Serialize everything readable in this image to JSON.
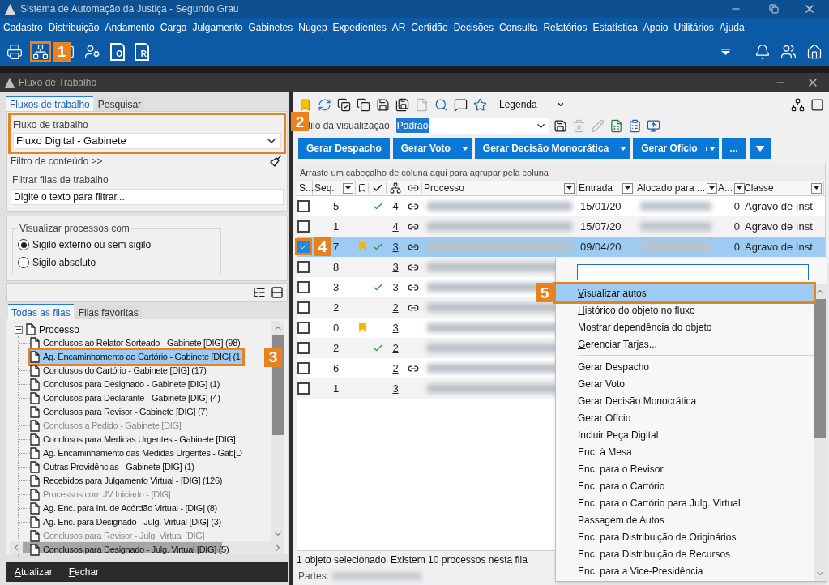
{
  "app_title": "Sistema de Automação da Justiça - Segundo Grau",
  "menu": [
    "Cadastro",
    "Distribuição",
    "Andamento",
    "Carga",
    "Julgamento",
    "Gabinetes",
    "Nugep",
    "Expedientes",
    "AR",
    "Certidão",
    "Decisões",
    "Consulta",
    "Relatórios",
    "Estatística",
    "Apoio",
    "Utilitários",
    "Ajuda"
  ],
  "toolbar": [
    {
      "kind": "printer"
    },
    {
      "kind": "org",
      "callout": "1"
    },
    {
      "kind": "window"
    },
    {
      "kind": "user-gear"
    },
    {
      "kind": "doc-letter",
      "letter": "O"
    },
    {
      "kind": "doc-letter",
      "letter": "R"
    }
  ],
  "window_title": "Fluxo de Trabalho",
  "left_tabs": [
    {
      "label": "Fluxos de trabalho",
      "selected": true
    },
    {
      "label": "Pesquisar",
      "selected": false
    }
  ],
  "workflow": {
    "label": "Fluxo de trabalho",
    "value": "Fluxo Digital - Gabinete",
    "callout": "2"
  },
  "content_filter": "Filtro de conteúdo >>",
  "queue_filter": {
    "label": "Filtrar filas de trabalho",
    "placeholder": "Digite o texto para filtrar..."
  },
  "visibility": {
    "legend": "Visualizar processos com",
    "options": [
      {
        "label": "Sigilo externo ou sem sigilo",
        "selected": true
      },
      {
        "label": "Sigilo absoluto",
        "selected": false
      }
    ]
  },
  "queue_tabs": [
    {
      "label": "Todas as filas",
      "selected": true
    },
    {
      "label": "Filas favoritas",
      "selected": false
    }
  ],
  "tree": {
    "label": "Processo",
    "expanded": true,
    "children": [
      {
        "label": "Conclusos ao Relator Sorteado - Gabinete [DIG] (98)",
        "selected": false,
        "disabled": false
      },
      {
        "label": "Ag. Encaminhamento ao Cartório - Gabinete [DIG] (1",
        "selected": true,
        "disabled": false,
        "callout": "3"
      },
      {
        "label": "Conclusos do Cartório - Gabinete [DIG] (17)",
        "selected": false,
        "disabled": false
      },
      {
        "label": "Conclusos para Designado - Gabinete [DIG] (1)",
        "selected": false,
        "disabled": false
      },
      {
        "label": "Conclusos para Declarante - Gabinete [DIG] (4)",
        "selected": false,
        "disabled": false
      },
      {
        "label": "Conclusos para Revisor - Gabinete [DIG] (7)",
        "selected": false,
        "disabled": false
      },
      {
        "label": "Conclusos a Pedido - Gabinete [DIG]",
        "selected": false,
        "disabled": true
      },
      {
        "label": "Conclusos para Medidas Urgentes - Gabinete [DIG]",
        "selected": false,
        "disabled": false
      },
      {
        "label": "Ag. Encaminhamento das Medidas Urgentes - Gab[D",
        "selected": false,
        "disabled": false
      },
      {
        "label": "Outras Providências - Gabinete [DIG] (1)",
        "selected": false,
        "disabled": false
      },
      {
        "label": "Recebidos para Julgamento Virtual - [DIG] (126)",
        "selected": false,
        "disabled": false
      },
      {
        "label": "Processos com JV Iniciado - [DIG]",
        "selected": false,
        "disabled": true
      },
      {
        "label": "Ag. Enc. para Int. de Acórdão Virtual - [DIG] (8)",
        "selected": false,
        "disabled": false
      },
      {
        "label": "Ag. Enc. para Designado - Julg. Virtual [DIG] (3)",
        "selected": false,
        "disabled": false
      },
      {
        "label": "Conclusos para Revisor - Julg. Virtual [DIG]",
        "selected": false,
        "disabled": true
      },
      {
        "label": "Conclusos para Designado - Julg. Virtual [DIG] (5)",
        "selected": false,
        "disabled": false
      }
    ]
  },
  "footer_buttons": [
    {
      "label": "Atualizar",
      "accelerator": true
    },
    {
      "label": "Fechar",
      "accelerator": true
    }
  ],
  "right_toolbar": {
    "tools": [
      {
        "kind": "bookmark",
        "disabled": false
      },
      {
        "kind": "refresh",
        "disabled": false
      },
      {
        "kind": "check-copy",
        "disabled": false
      },
      {
        "kind": "copy",
        "disabled": false
      },
      {
        "kind": "save",
        "disabled": false
      },
      {
        "kind": "save-all",
        "disabled": false
      },
      {
        "kind": "file",
        "disabled": true
      },
      {
        "kind": "search",
        "disabled": false
      },
      {
        "kind": "comment",
        "disabled": false
      },
      {
        "kind": "star",
        "disabled": false
      }
    ],
    "legend": "Legenda",
    "side_tools": [
      {
        "kind": "network",
        "disabled": false
      },
      {
        "kind": "rows",
        "disabled": false
      }
    ]
  },
  "view_style": {
    "label": "tilo da visualização",
    "value": "Padrão",
    "tools": [
      {
        "kind": "save",
        "disabled": false
      },
      {
        "kind": "trash",
        "disabled": true
      },
      {
        "kind": "pencil",
        "disabled": true
      },
      {
        "kind": "spreadsheet",
        "disabled": false
      },
      {
        "kind": "clipboard",
        "disabled": false
      },
      {
        "kind": "monitor-up",
        "disabled": false
      }
    ]
  },
  "action_buttons": [
    {
      "label": "Gerar Despacho",
      "dropdown": false
    },
    {
      "label": "Gerar Voto",
      "dropdown": true
    },
    {
      "label": "Gerar Decisão Monocrática",
      "dropdown": true
    },
    {
      "label": "Gerar Ofício",
      "dropdown": true
    },
    {
      "label": "...",
      "dropdown": false
    }
  ],
  "group_hint": "Arraste um cabeçalho de coluna aqui para agrupar pela coluna",
  "columns": [
    {
      "label": "S..."
    },
    {
      "label": "Seq.",
      "filter": true
    },
    {
      "label": "Processo",
      "filter": true
    },
    {
      "label": "Entrada",
      "filter": true
    },
    {
      "label": "Alocado para ...",
      "filter": true
    },
    {
      "label": "A...",
      "filter": true
    },
    {
      "label": "Classe",
      "filter": true
    }
  ],
  "rows": [
    {
      "checked": false,
      "selected": false,
      "seq": "5",
      "flagged": false,
      "done": true,
      "count": "4",
      "linked": true,
      "entrada": "15/01/20",
      "a": "0",
      "classe": "Agravo de Inst"
    },
    {
      "checked": false,
      "selected": false,
      "seq": "1",
      "flagged": false,
      "done": false,
      "count": "4",
      "linked": true,
      "entrada": "15/07/20",
      "a": "0",
      "classe": "Agravo de Inst"
    },
    {
      "checked": true,
      "selected": true,
      "seq": "7",
      "flagged": true,
      "done": true,
      "count": "3",
      "linked": true,
      "entrada": "09/04/20",
      "a": "0",
      "classe": "Agravo de Inst",
      "callout": "4"
    },
    {
      "checked": false,
      "selected": false,
      "seq": "8",
      "flagged": false,
      "done": false,
      "count": "3",
      "linked": true
    },
    {
      "checked": false,
      "selected": false,
      "seq": "3",
      "flagged": false,
      "done": true,
      "count": "3",
      "linked": true
    },
    {
      "checked": false,
      "selected": false,
      "seq": "2",
      "flagged": false,
      "done": false,
      "count": "2",
      "linked": true
    },
    {
      "checked": false,
      "selected": false,
      "seq": "0",
      "flagged": true,
      "done": false,
      "count": "3",
      "linked": false
    },
    {
      "checked": false,
      "selected": false,
      "seq": "2",
      "flagged": false,
      "done": true,
      "count": "2",
      "linked": false
    },
    {
      "checked": false,
      "selected": false,
      "seq": "6",
      "flagged": false,
      "done": false,
      "count": "2",
      "linked": true
    },
    {
      "checked": false,
      "selected": false,
      "seq": "1",
      "flagged": false,
      "done": false,
      "count": "3",
      "linked": false
    }
  ],
  "status": {
    "selection": "1 objeto selecionado",
    "total": "Existem 10 processos nesta fila",
    "parties_label": "Partes:"
  },
  "context_menu": {
    "items": [
      {
        "kind": "item",
        "label": "Visualizar autos",
        "accelerator": true,
        "selected": true,
        "callout": "5"
      },
      {
        "kind": "item",
        "label": "Histórico do objeto no fluxo",
        "accelerator": true,
        "selected": false
      },
      {
        "kind": "item",
        "label": "Mostrar dependência do objeto",
        "accelerator": false,
        "selected": false
      },
      {
        "kind": "item",
        "label": "Gerenciar Tarjas...",
        "accelerator": true,
        "selected": false
      },
      {
        "kind": "separator"
      },
      {
        "kind": "item",
        "label": "Gerar Despacho",
        "accelerator": false,
        "selected": false
      },
      {
        "kind": "item",
        "label": "Gerar Voto",
        "accelerator": false,
        "selected": false
      },
      {
        "kind": "item",
        "label": "Gerar Decisão Monocrática",
        "accelerator": false,
        "selected": false
      },
      {
        "kind": "item",
        "label": "Gerar Ofício",
        "accelerator": false,
        "selected": false
      },
      {
        "kind": "item",
        "label": "Incluir Peça Digital",
        "accelerator": false,
        "selected": false
      },
      {
        "kind": "item",
        "label": "Enc. à Mesa",
        "accelerator": false,
        "selected": false
      },
      {
        "kind": "item",
        "label": "Enc. para o Revisor",
        "accelerator": false,
        "selected": false
      },
      {
        "kind": "item",
        "label": "Enc. para o Cartório",
        "accelerator": false,
        "selected": false
      },
      {
        "kind": "item",
        "label": "Enc. para o Cartório para Julg. Virtual",
        "accelerator": false,
        "selected": false
      },
      {
        "kind": "item",
        "label": "Passagem de Autos",
        "accelerator": false,
        "selected": false
      },
      {
        "kind": "item",
        "label": "Enc. para Distribuição de Originários",
        "accelerator": false,
        "selected": false
      },
      {
        "kind": "item",
        "label": "Enc. para Distribuição de Recursos",
        "accelerator": false,
        "selected": false
      },
      {
        "kind": "item",
        "label": "Enc. para a Vice-Presidência",
        "accelerator": false,
        "selected": false
      }
    ]
  }
}
